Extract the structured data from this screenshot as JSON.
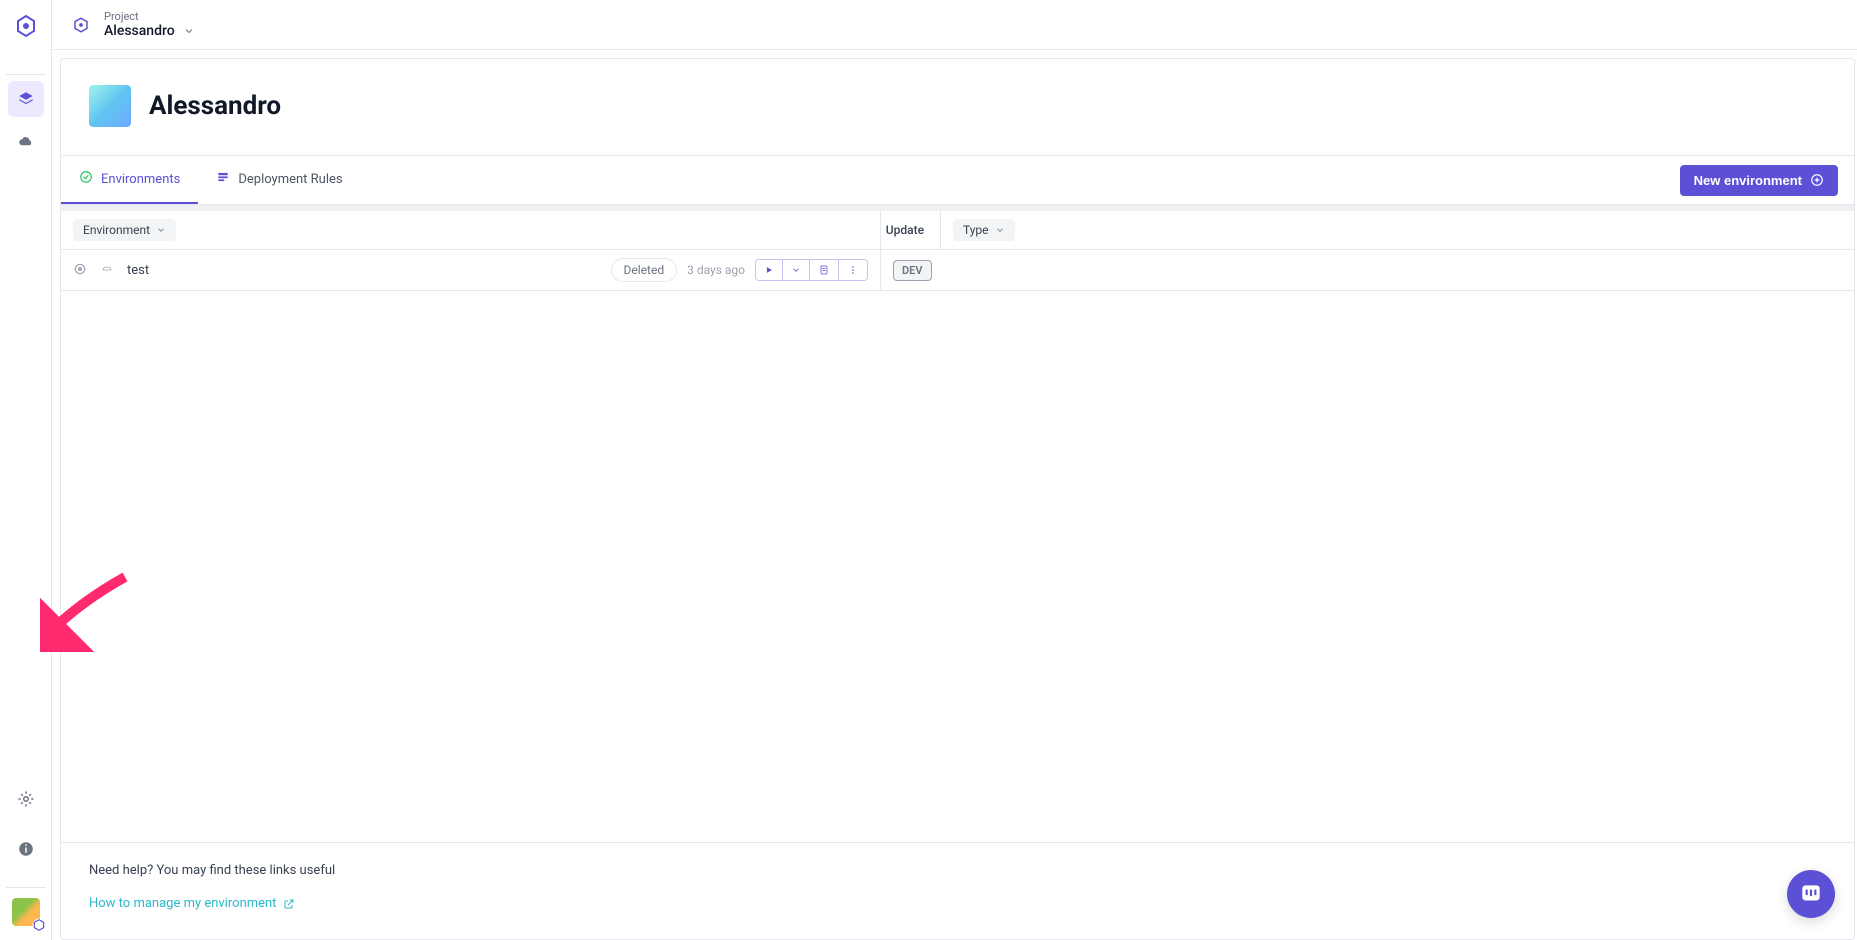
{
  "header": {
    "project_label": "Project",
    "project_name": "Alessandro"
  },
  "page": {
    "title": "Alessandro"
  },
  "tabs": {
    "environments": "Environments",
    "deployment_rules": "Deployment Rules"
  },
  "actions": {
    "new_environment": "New environment"
  },
  "columns": {
    "environment": "Environment",
    "update": "Update",
    "type": "Type"
  },
  "rows": [
    {
      "name": "test",
      "state": "Deleted",
      "time": "3 days ago",
      "type": "DEV"
    }
  ],
  "help": {
    "title": "Need help? You may find these links useful",
    "link": "How to manage my environment"
  }
}
